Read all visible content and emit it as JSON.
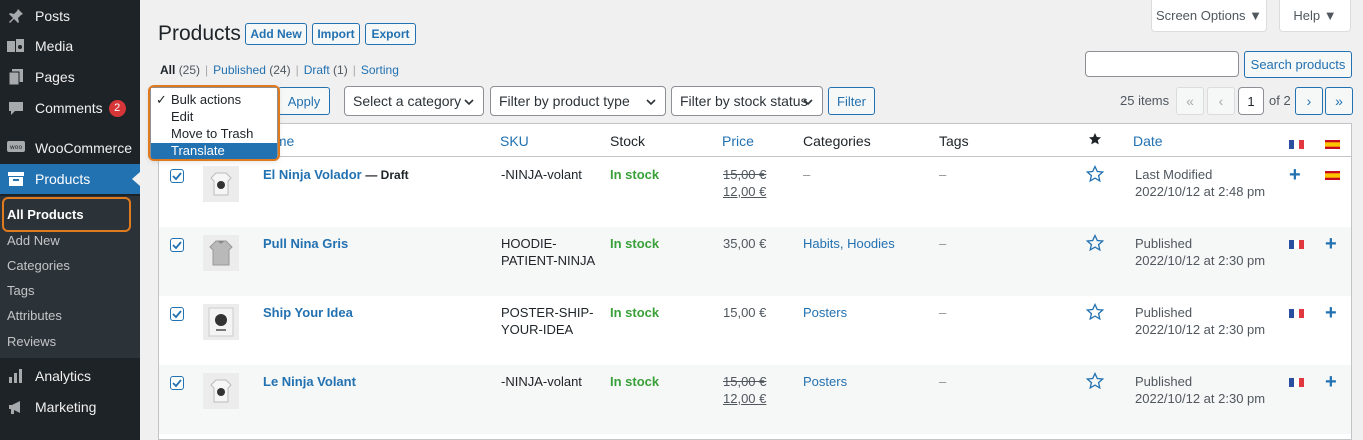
{
  "sidebar": {
    "items": [
      {
        "label": "Posts",
        "icon": "pin-icon"
      },
      {
        "label": "Media",
        "icon": "media-icon"
      },
      {
        "label": "Pages",
        "icon": "pages-icon"
      },
      {
        "label": "Comments",
        "icon": "comment-icon",
        "badge": "2"
      },
      {
        "label": "WooCommerce",
        "icon": "woocommerce-icon"
      },
      {
        "label": "Products",
        "icon": "archive-icon"
      },
      {
        "label": "Analytics",
        "icon": "analytics-icon"
      },
      {
        "label": "Marketing",
        "icon": "megaphone-icon"
      }
    ],
    "submenu": [
      "All Products",
      "Add New",
      "Categories",
      "Tags",
      "Attributes",
      "Reviews"
    ]
  },
  "header": {
    "title": "Products",
    "add_new": "Add New",
    "import": "Import",
    "export": "Export",
    "screen_options": "Screen Options ▼",
    "help": "Help ▼"
  },
  "views": {
    "all": "All",
    "all_count": "(25)",
    "published": "Published",
    "published_count": "(24)",
    "draft": "Draft",
    "draft_count": "(1)",
    "sorting": "Sorting",
    "separator": "|"
  },
  "search": {
    "value": "",
    "button": "Search products"
  },
  "toolbar": {
    "apply": "Apply",
    "category": "Select a category",
    "product_type": "Filter by product type",
    "stock_status": "Filter by stock status",
    "filter": "Filter"
  },
  "bulk_actions": {
    "options": [
      "Bulk actions",
      "Edit",
      "Move to Trash",
      "Translate"
    ],
    "checked": "Bulk actions",
    "highlighted": "Translate"
  },
  "pagination": {
    "count": "25 items",
    "first": "«",
    "prev": "‹",
    "current": "1",
    "of": "of 2",
    "next": "›",
    "last": "»"
  },
  "table": {
    "columns": {
      "name": "Name",
      "sku": "SKU",
      "stock": "Stock",
      "price": "Price",
      "categories": "Categories",
      "tags": "Tags",
      "date": "Date"
    },
    "rows": [
      {
        "name": "El Ninja Volador",
        "state": "— Draft",
        "sku": "-NINJA-volant",
        "stock": "In stock",
        "price_old": "15,00 €",
        "price_new": "12,00 €",
        "categories": "–",
        "tags": "–",
        "date_status": "Last Modified",
        "date": "2022/10/12 at 2:48 pm"
      },
      {
        "name": "Pull Nina Gris",
        "state": "",
        "sku": "HOODIE-PATIENT-NINJA",
        "stock": "In stock",
        "price": "35,00 €",
        "categories": "Habits, Hoodies",
        "tags": "–",
        "date_status": "Published",
        "date": "2022/10/12 at 2:30 pm"
      },
      {
        "name": "Ship Your Idea",
        "state": "",
        "sku": "POSTER-SHIP-YOUR-IDEA",
        "stock": "In stock",
        "price": "15,00 €",
        "categories": "Posters",
        "tags": "–",
        "date_status": "Published",
        "date": "2022/10/12 at 2:30 pm"
      },
      {
        "name": "Le Ninja Volant",
        "state": "",
        "sku": "-NINJA-volant",
        "stock": "In stock",
        "price_old": "15,00 €",
        "price_new": "12,00 €",
        "categories": "Posters",
        "tags": "–",
        "date_status": "Published",
        "date": "2022/10/12 at 2:30 pm"
      }
    ]
  },
  "colors": {
    "accent": "#2271b1",
    "highlight": "#e07a1f",
    "sidebar": "#1d2327",
    "in_stock": "#3aa13a"
  }
}
